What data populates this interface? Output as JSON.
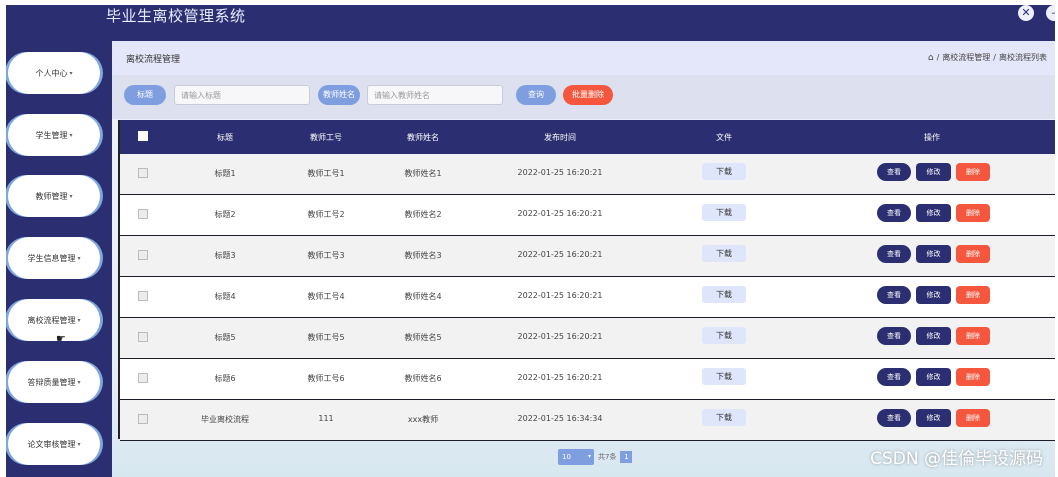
{
  "app": {
    "title": "毕业生离校管理系统"
  },
  "window_buttons": {
    "close_glyph": "✕",
    "other_glyph": "–"
  },
  "sidebar": {
    "items": [
      {
        "label": "个人中心"
      },
      {
        "label": "学生管理"
      },
      {
        "label": "教师管理"
      },
      {
        "label": "学生信息管理"
      },
      {
        "label": "离校流程管理"
      },
      {
        "label": "答辩质量管理"
      },
      {
        "label": "论文审核管理"
      }
    ],
    "caret": "▾"
  },
  "page": {
    "title": "离校流程管理",
    "breadcrumb": [
      "离校流程管理",
      "离校流程列表"
    ],
    "breadcrumb_sep": "/"
  },
  "search": {
    "title_tag": "标题",
    "title_placeholder": "请输入标题",
    "teacher_tag": "教师姓名",
    "teacher_placeholder": "请输入教师姓名",
    "query_label": "查询",
    "batch_delete_label": "批量删除"
  },
  "table": {
    "columns": [
      "标题",
      "教师工号",
      "教师姓名",
      "发布时间",
      "文件",
      "操作"
    ],
    "rows": [
      {
        "title": "标题1",
        "teacher_no": "教师工号1",
        "teacher_name": "教师姓名1",
        "time": "2022-01-25 16:20:21"
      },
      {
        "title": "标题2",
        "teacher_no": "教师工号2",
        "teacher_name": "教师姓名2",
        "time": "2022-01-25 16:20:21"
      },
      {
        "title": "标题3",
        "teacher_no": "教师工号3",
        "teacher_name": "教师姓名3",
        "time": "2022-01-25 16:20:21"
      },
      {
        "title": "标题4",
        "teacher_no": "教师工号4",
        "teacher_name": "教师姓名4",
        "time": "2022-01-25 16:20:21"
      },
      {
        "title": "标题5",
        "teacher_no": "教师工号5",
        "teacher_name": "教师姓名5",
        "time": "2022-01-25 16:20:21"
      },
      {
        "title": "标题6",
        "teacher_no": "教师工号6",
        "teacher_name": "教师姓名6",
        "time": "2022-01-25 16:20:21"
      },
      {
        "title": "毕业离校流程",
        "teacher_no": "111",
        "teacher_name": "xxx教师",
        "time": "2022-01-25 16:34:34"
      }
    ],
    "download_label": "下载",
    "view_label": "查看",
    "edit_label": "修改",
    "delete_label": "删除"
  },
  "pagination": {
    "page_size": "10",
    "total": "共7条",
    "current_page": "1"
  },
  "watermark": "CSDN @佳倫毕设源码",
  "colors": {
    "navy": "#2b2f72",
    "accent_blue": "#7f9ee0",
    "danger": "#f4573e"
  }
}
